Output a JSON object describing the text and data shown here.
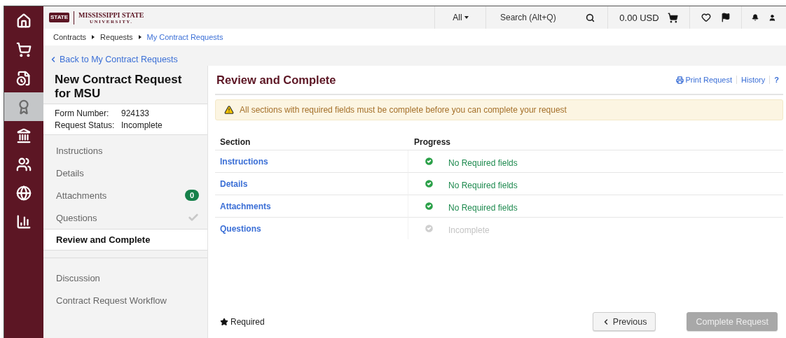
{
  "header": {
    "logo": {
      "emblem": "STATE",
      "name": "MISSISSIPPI STATE",
      "sub": "UNIVERSITY."
    },
    "search_scope": "All",
    "search": {
      "placeholder": "Search (Alt+Q)"
    },
    "cart_total": "0.00 USD"
  },
  "rail": [
    {
      "selected": false
    },
    {
      "selected": false
    },
    {
      "selected": false
    },
    {
      "selected": true
    },
    {
      "selected": false
    },
    {
      "selected": false
    },
    {
      "selected": false
    },
    {
      "selected": false
    }
  ],
  "breadcrumb": [
    {
      "label": "Contracts",
      "link": false
    },
    {
      "label": "Requests",
      "link": false
    },
    {
      "label": "My Contract Requests",
      "link": true
    }
  ],
  "back_link": "Back to My Contract Requests",
  "form": {
    "title": "New Contract Request for MSU",
    "fields": [
      {
        "label": "Form Number:",
        "value": "924133"
      },
      {
        "label": "Request Status:",
        "value": "Incomplete"
      }
    ]
  },
  "nav_groups": [
    [
      {
        "label": "Instructions",
        "selected": false
      },
      {
        "label": "Details",
        "selected": false
      },
      {
        "label": "Attachments",
        "selected": false,
        "badge": "0"
      },
      {
        "label": "Questions",
        "selected": false,
        "done": false
      },
      {
        "label": "Review and Complete",
        "selected": true
      }
    ],
    [
      {
        "label": "Discussion",
        "selected": false
      },
      {
        "label": "Contract Request Workflow",
        "selected": false
      }
    ]
  ],
  "main": {
    "title": "Review and Complete",
    "actions": [
      "Print Request",
      "History",
      "?"
    ],
    "alert": "All sections with required fields must be complete before you can complete your request",
    "table": {
      "columns": [
        "Section",
        "Progress"
      ],
      "rows": [
        {
          "section": "Instructions",
          "progress": "No Required fields",
          "complete": true
        },
        {
          "section": "Details",
          "progress": "No Required fields",
          "complete": true
        },
        {
          "section": "Attachments",
          "progress": "No Required fields",
          "complete": true
        },
        {
          "section": "Questions",
          "progress": "Incomplete",
          "complete": false
        }
      ]
    },
    "required_note": "Required",
    "buttons": [
      {
        "label": "Previous",
        "disabled": false
      },
      {
        "label": "Complete Request",
        "disabled": true
      }
    ]
  }
}
